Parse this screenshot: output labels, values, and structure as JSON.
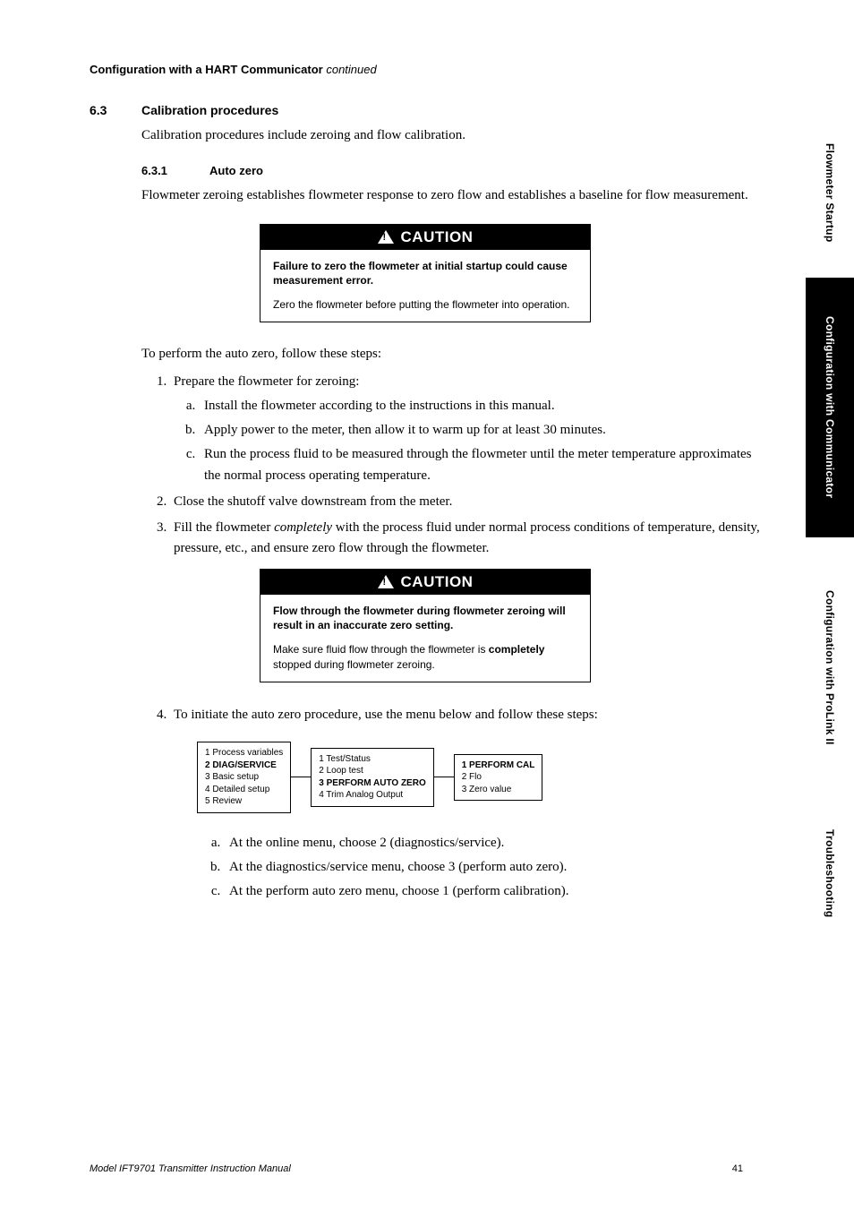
{
  "runningHead": {
    "title": "Configuration with a HART Communicator",
    "continued": "continued"
  },
  "section": {
    "num": "6.3",
    "title": "Calibration procedures",
    "intro": "Calibration procedures include zeroing and flow calibration."
  },
  "subsection": {
    "num": "6.3.1",
    "title": "Auto zero",
    "intro": "Flowmeter zeroing establishes flowmeter response to zero flow and establishes a baseline for flow measurement."
  },
  "caution1": {
    "heading": "CAUTION",
    "bold": "Failure to zero the flowmeter at initial startup could cause measurement error.",
    "text": "Zero the flowmeter before putting the flowmeter into operation."
  },
  "stepsIntro": "To perform the auto zero, follow these steps:",
  "step1": {
    "text": "Prepare the flowmeter for zeroing:",
    "a": "Install the flowmeter according to the instructions in this manual.",
    "b": "Apply power to the meter, then allow it to warm up for at least 30 minutes.",
    "c": "Run the process fluid to be measured through the flowmeter until the meter temperature approximates the normal process operating temperature."
  },
  "step2": "Close the shutoff valve downstream from the meter.",
  "step3_pre": "Fill the flowmeter ",
  "step3_em": "completely",
  "step3_post": " with the process fluid under normal process conditions of temperature, density, pressure, etc., and ensure zero flow through the flowmeter.",
  "caution2": {
    "heading": "CAUTION",
    "bold": "Flow through the flowmeter during flowmeter zeroing will result in an inaccurate zero setting.",
    "text_pre": "Make sure fluid flow through the flowmeter is ",
    "text_bold": "completely",
    "text_post": " stopped during flowmeter zeroing."
  },
  "step4": "To initiate the auto zero procedure, use the menu below and follow these steps:",
  "menu1": {
    "l1": "1  Process variables",
    "l2": "2  DIAG/SERVICE",
    "l3": "3  Basic setup",
    "l4": "4  Detailed setup",
    "l5": "5  Review"
  },
  "menu2": {
    "l1": "1  Test/Status",
    "l2": "2  Loop test",
    "l3": "3  PERFORM AUTO ZERO",
    "l4": "4  Trim Analog Output"
  },
  "menu3": {
    "l1": "1  PERFORM CAL",
    "l2": "2  Flo",
    "l3": "3  Zero value"
  },
  "step4sub": {
    "a": "At the online menu, choose 2 (diagnostics/service).",
    "b": "At the diagnostics/service menu, choose 3 (perform auto zero).",
    "c": "At the perform auto zero menu, choose 1 (perform calibration)."
  },
  "footer": {
    "left": "Model IFT9701 Transmitter Instruction Manual",
    "page": "41"
  },
  "tabs": {
    "t1": "Flowmeter Startup",
    "t2": "Configuration with Communicator",
    "t3": "Configuration with ProLink II",
    "t4": "Troubleshooting"
  }
}
